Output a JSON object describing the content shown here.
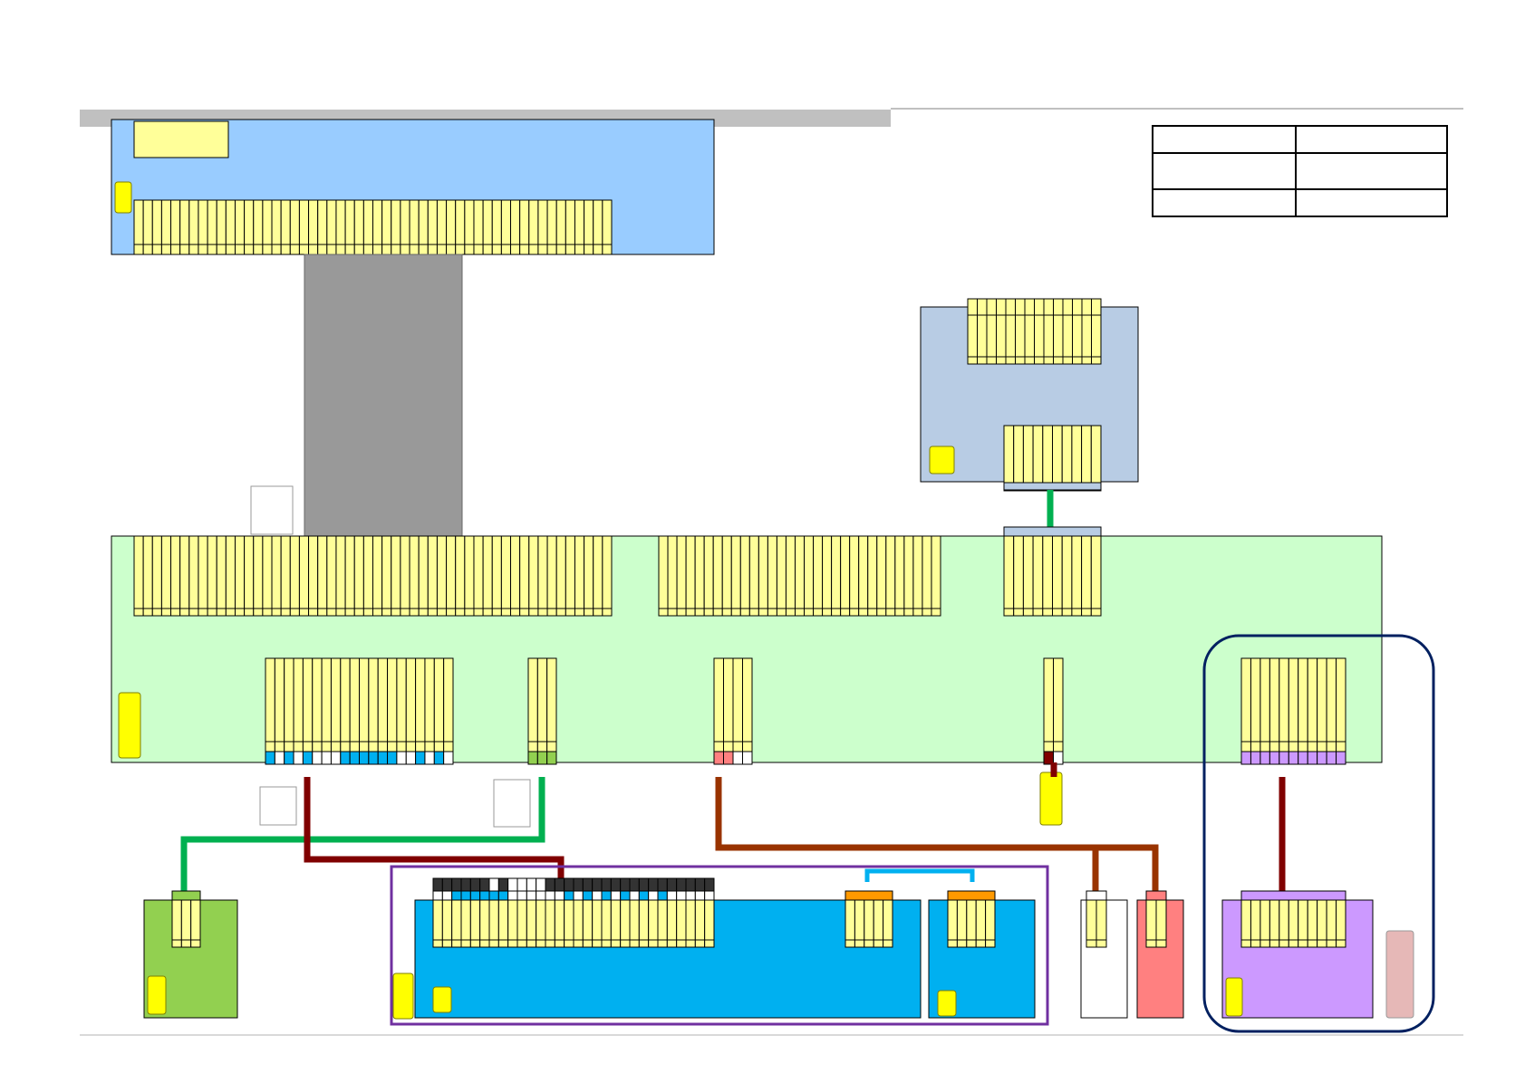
{
  "diagram": {
    "title": "",
    "legend": {
      "rows": [
        [
          "",
          ""
        ],
        [
          "",
          ""
        ],
        [
          "",
          ""
        ]
      ]
    },
    "colors": {
      "main_board": "#ccffcc",
      "top_board": "#99ccff",
      "upper_right_board": "#b8cce4",
      "flat_cable": "#999999",
      "pin": "#ffff99",
      "chip": "#ffff00",
      "green_board": "#92d050",
      "blue_board": "#00b0f0",
      "red_board": "#ff8080",
      "purple_board": "#cc99ff",
      "pink_block": "#e6b8b7",
      "wire_green": "#00b050",
      "wire_darkred": "#800000",
      "wire_brown": "#993300",
      "wire_cyan": "#00b0f0",
      "group_purple": "#7030a0",
      "group_navy": "#002060",
      "header_bar": "#c0c0c0"
    },
    "connectors": [
      {
        "id": "top-board-header",
        "pins": 52
      },
      {
        "id": "main-board-cn-a",
        "pins": 52
      },
      {
        "id": "main-board-cn-b",
        "pins": 31
      },
      {
        "id": "main-board-cn-c",
        "pins": 10
      },
      {
        "id": "upper-right-cn-top",
        "pins": 14
      },
      {
        "id": "upper-right-cn-bottom",
        "pins": 10
      },
      {
        "id": "main-board-cn-d",
        "pins": 20
      },
      {
        "id": "main-board-cn-e",
        "pins": 3
      },
      {
        "id": "main-board-cn-f",
        "pins": 4
      },
      {
        "id": "main-board-cn-g",
        "pins": 2
      },
      {
        "id": "main-board-cn-h",
        "pins": 11
      },
      {
        "id": "blue-board-cn-a",
        "pins": 30
      },
      {
        "id": "blue-board-cn-b",
        "pins": 5
      },
      {
        "id": "blue-board-cn-c",
        "pins": 5
      },
      {
        "id": "green-board-cn",
        "pins": 3
      },
      {
        "id": "white-board-cn",
        "pins": 2
      },
      {
        "id": "red-board-cn",
        "pins": 2
      },
      {
        "id": "purple-board-cn",
        "pins": 11
      }
    ]
  }
}
